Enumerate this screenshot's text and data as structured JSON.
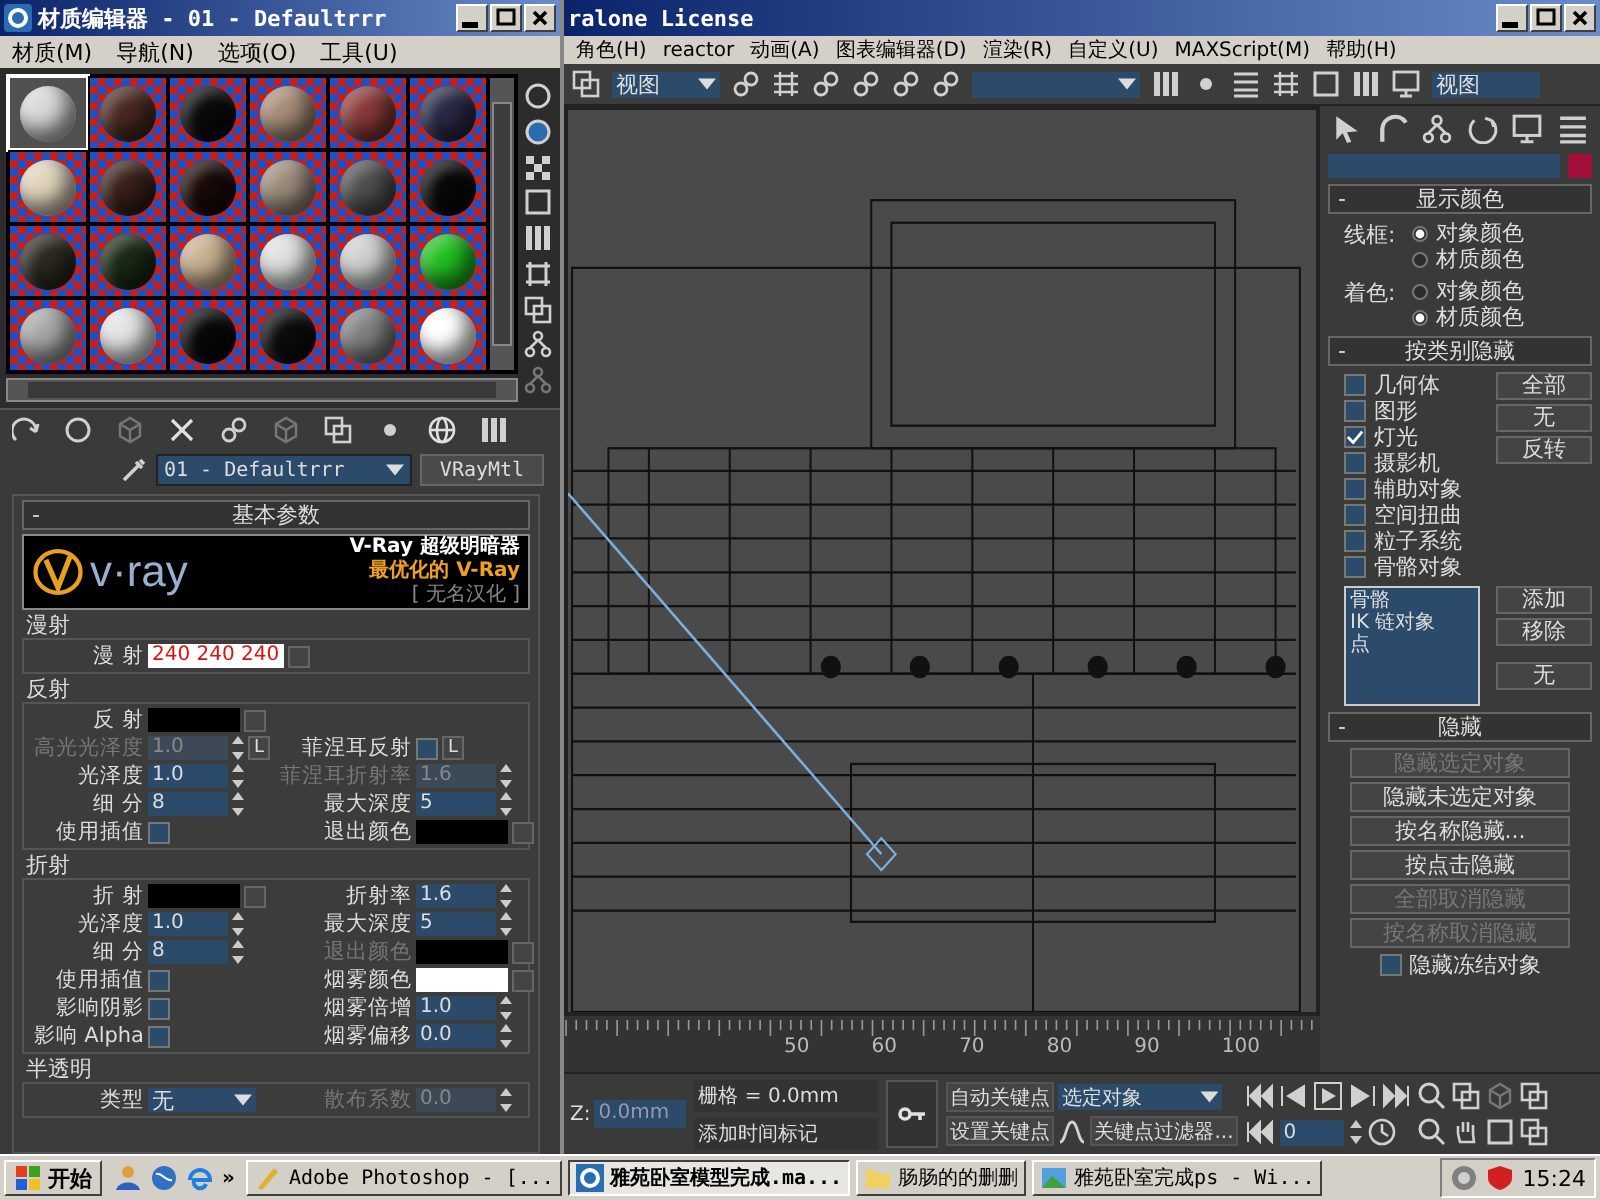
{
  "material_editor": {
    "title": "材质编辑器 - 01 - Defaultrrr",
    "menu": [
      "材质(M)",
      "导航(N)",
      "选项(O)",
      "工具(U)"
    ],
    "slots": [
      {
        "color": "#d8d8d8",
        "selected": true
      },
      {
        "color": "#4a2a22",
        "selected": false
      },
      {
        "color": "#0a0a0a",
        "selected": false
      },
      {
        "color": "#a88c78",
        "selected": false
      },
      {
        "color": "#8a3a3a",
        "selected": false
      },
      {
        "color": "#2a2a48",
        "selected": false
      },
      {
        "color": "#e0d4bc",
        "selected": false
      },
      {
        "color": "#3a2018",
        "selected": false
      },
      {
        "color": "#1a0a08",
        "selected": false
      },
      {
        "color": "#9c8c7c",
        "selected": false
      },
      {
        "color": "#505050",
        "selected": false
      },
      {
        "color": "#080808",
        "selected": false
      },
      {
        "color": "#2c2a20",
        "selected": false
      },
      {
        "color": "#1a2a15",
        "selected": false
      },
      {
        "color": "#c8b090",
        "selected": false
      },
      {
        "color": "#e0e0e0",
        "selected": false
      },
      {
        "color": "#d0d0d0",
        "selected": false
      },
      {
        "color": "#20c020",
        "selected": false
      },
      {
        "color": "#a8a8a8",
        "selected": false
      },
      {
        "color": "#e4e4e4",
        "selected": false
      },
      {
        "color": "#080808",
        "selected": false
      },
      {
        "color": "#0c0c0c",
        "selected": false
      },
      {
        "color": "#808080",
        "selected": false
      },
      {
        "color": "#ffffff",
        "selected": false
      }
    ],
    "material_name": "01 - Defaultrrr",
    "material_type": "VRayMtl",
    "rollout": {
      "toggle": "-",
      "title": "基本参数"
    },
    "banner": {
      "logo": "v·ray",
      "line_1": "V-Ray 超级明暗器",
      "line_2": "最优化的 V-Ray",
      "line_3": "[ 无名汉化 ]"
    },
    "groups": [
      {
        "title": "漫射",
        "rows": [
          {
            "left": {
              "kind": "color",
              "label": "漫 射",
              "color": "#ffffff",
              "value": "240 240 240",
              "disabled": false
            }
          }
        ]
      },
      {
        "title": "反射",
        "rows": [
          {
            "left": {
              "kind": "color",
              "label": "反 射",
              "color": "#000000",
              "disabled": false
            }
          },
          {
            "left": {
              "kind": "spinner",
              "label": "高光光泽度",
              "value": "1.0",
              "disabled": true,
              "button": "L"
            },
            "right": {
              "kind": "checkbox",
              "label": "菲涅耳反射",
              "checked": false,
              "disabled": false,
              "button": "L"
            }
          },
          {
            "left": {
              "kind": "spinner",
              "label": "光泽度",
              "value": "1.0",
              "disabled": false
            },
            "right": {
              "kind": "spinner",
              "label": "菲涅耳折射率",
              "value": "1.6",
              "disabled": true
            }
          },
          {
            "left": {
              "kind": "spinner",
              "label": "细 分",
              "value": "8",
              "disabled": false
            },
            "right": {
              "kind": "spinner",
              "label": "最大深度",
              "value": "5",
              "disabled": false
            }
          },
          {
            "left": {
              "kind": "checkbox",
              "label": "使用插值",
              "checked": false,
              "disabled": false
            },
            "right": {
              "kind": "color",
              "label": "退出颜色",
              "color": "#000000",
              "disabled": false
            }
          }
        ]
      },
      {
        "title": "折射",
        "rows": [
          {
            "left": {
              "kind": "color",
              "label": "折 射",
              "color": "#000000",
              "disabled": false
            },
            "right": {
              "kind": "spinner",
              "label": "折射率",
              "value": "1.6",
              "disabled": false
            }
          },
          {
            "left": {
              "kind": "spinner",
              "label": "光泽度",
              "value": "1.0",
              "disabled": false
            },
            "right": {
              "kind": "spinner",
              "label": "最大深度",
              "value": "5",
              "disabled": false
            }
          },
          {
            "left": {
              "kind": "spinner",
              "label": "细 分",
              "value": "8",
              "disabled": false
            },
            "right": {
              "kind": "color",
              "label": "退出颜色",
              "color": "#000000",
              "disabled": true
            }
          },
          {
            "left": {
              "kind": "checkbox",
              "label": "使用插值",
              "checked": false,
              "disabled": false
            },
            "right": {
              "kind": "color",
              "label": "烟雾颜色",
              "color": "#ffffff",
              "disabled": false
            }
          },
          {
            "left": {
              "kind": "checkbox",
              "label": "影响阴影",
              "checked": false,
              "disabled": false
            },
            "right": {
              "kind": "spinner",
              "label": "烟雾倍增",
              "value": "1.0",
              "disabled": false
            }
          },
          {
            "left": {
              "kind": "checkbox",
              "label": "影响 Alpha",
              "checked": false,
              "disabled": false
            },
            "right": {
              "kind": "spinner",
              "label": "烟雾偏移",
              "value": "0.0",
              "disabled": false
            }
          }
        ]
      },
      {
        "title": "半透明",
        "rows": [
          {
            "left": {
              "kind": "dropdown",
              "label": "类型",
              "value": "无",
              "disabled": false
            },
            "right": {
              "kind": "spinner",
              "label": "散布系数",
              "value": "0.0",
              "disabled": true
            }
          }
        ]
      }
    ]
  },
  "main_window": {
    "title": "ralone License",
    "menu": [
      "角色(H)",
      "reactor",
      "动画(A)",
      "图表编辑器(D)",
      "渲染(R)",
      "自定义(U)",
      "MAXScript(M)",
      "帮助(H)"
    ],
    "toolbar": {
      "reference_dropdown": "视图",
      "viewport_dropdown": "视图"
    },
    "ruler_labels": [
      "50",
      "60",
      "70",
      "80",
      "90",
      "100"
    ],
    "command_panel": {
      "display_color": {
        "toggle": "-",
        "title": "显示颜色",
        "groups": [
          {
            "label": "线框:",
            "options": [
              {
                "label": "对象颜色",
                "selected": true
              },
              {
                "label": "材质颜色",
                "selected": false
              }
            ]
          },
          {
            "label": "着色:",
            "options": [
              {
                "label": "对象颜色",
                "selected": false
              },
              {
                "label": "材质颜色",
                "selected": true
              }
            ]
          }
        ]
      },
      "hide_by_category": {
        "toggle": "-",
        "title": "按类别隐藏",
        "categories": [
          {
            "label": "几何体",
            "checked": false
          },
          {
            "label": "图形",
            "checked": false
          },
          {
            "label": "灯光",
            "checked": true
          },
          {
            "label": "摄影机",
            "checked": false
          },
          {
            "label": "辅助对象",
            "checked": false
          },
          {
            "label": "空间扭曲",
            "checked": false
          },
          {
            "label": "粒子系统",
            "checked": false
          },
          {
            "label": "骨骼对象",
            "checked": false
          }
        ],
        "buttons": [
          "全部",
          "无",
          "反转"
        ],
        "list": [
          "骨骼",
          "IK 链对象",
          "点"
        ],
        "list_buttons": [
          "添加",
          "移除",
          "无"
        ]
      },
      "hide": {
        "toggle": "-",
        "title": "隐藏",
        "buttons": [
          {
            "label": "隐藏选定对象",
            "disabled": true
          },
          {
            "label": "隐藏未选定对象",
            "disabled": false
          },
          {
            "label": "按名称隐藏...",
            "disabled": false
          },
          {
            "label": "按点击隐藏",
            "disabled": false
          },
          {
            "label": "全部取消隐藏",
            "disabled": true
          },
          {
            "label": "按名称取消隐藏",
            "disabled": true
          }
        ],
        "freeze_checkbox": {
          "label": "隐藏冻结对象",
          "checked": false
        }
      }
    },
    "bottom": {
      "z_label": "Z:",
      "z_value": "0.0mm",
      "grid": "栅格 = 0.0mm",
      "add_time_tag": "添加时间标记",
      "auto_key": "自动关键点",
      "key_mode": "选定对象",
      "set_key": "设置关键点",
      "key_filters": "关键点过滤器...",
      "frame": "0"
    }
  },
  "taskbar": {
    "start": "开始",
    "overflow": "»",
    "tasks": [
      {
        "kind": "photoshop",
        "label": "Adobe Photoshop - [...",
        "selected": false
      },
      {
        "kind": "max",
        "label": "雅苑卧室模型完成.ma...",
        "selected": true
      },
      {
        "kind": "folder",
        "label": "肠肠的的删删",
        "selected": false
      },
      {
        "kind": "viewer",
        "label": "雅苑卧室完成ps - Wi...",
        "selected": false
      }
    ],
    "clock": "15:24"
  }
}
